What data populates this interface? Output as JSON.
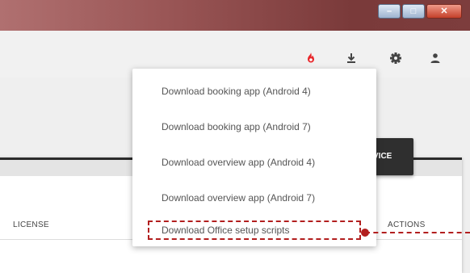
{
  "window": {
    "minimize_glyph": "–",
    "maximize_glyph": "□",
    "close_glyph": "✕"
  },
  "toolbar": {
    "icons": [
      "fire-icon",
      "download-icon",
      "gear-icon",
      "person-icon"
    ],
    "accent_color": "#e8262a"
  },
  "device_button": {
    "label": "VICE"
  },
  "table": {
    "columns": [
      "LICENSE",
      "ACTIONS"
    ]
  },
  "download_menu": {
    "items": [
      "Download booking app (Android 4)",
      "Download booking app (Android 7)",
      "Download overview app (Android 4)",
      "Download overview app (Android 7)",
      "Download Office setup scripts"
    ],
    "highlighted_index": 4
  },
  "annotation_color": "#b21f1f"
}
